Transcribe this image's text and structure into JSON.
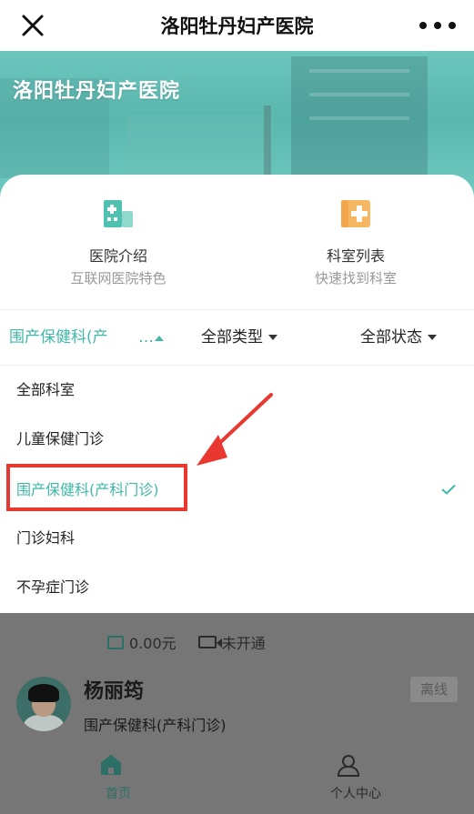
{
  "navbar": {
    "title": "洛阳牡丹妇产医院",
    "close_icon": "close-icon",
    "more_icon": "more-dots-icon"
  },
  "banner": {
    "hospital_name": "洛阳牡丹妇产医院"
  },
  "quick_links": [
    {
      "title": "医院介绍",
      "subtitle": "互联网医院特色",
      "icon": "hospital-building-icon"
    },
    {
      "title": "科室列表",
      "subtitle": "快速找到科室",
      "icon": "department-plus-icon"
    }
  ],
  "filters": {
    "department": {
      "label": "围产保健科(产科门诊)",
      "visible_label": "围产保健科(产",
      "ellipsis": "…"
    },
    "type": {
      "label": "全部类型"
    },
    "status": {
      "label": "全部状态"
    }
  },
  "dropdown": {
    "items": [
      {
        "label": "全部科室",
        "selected": false
      },
      {
        "label": "儿童保健门诊",
        "selected": false
      },
      {
        "label": "围产保健科(产科门诊)",
        "selected": true
      },
      {
        "label": "门诊妇科",
        "selected": false
      },
      {
        "label": "不孕症门诊",
        "selected": false
      }
    ]
  },
  "doctor_card": {
    "price": "0.00元",
    "video_status": "未开通",
    "name": "杨丽筠",
    "department": "围产保健科(产科门诊)",
    "badge": "离线"
  },
  "tabbar": {
    "items": [
      {
        "label": "首页",
        "icon": "home-icon",
        "active": true
      },
      {
        "label": "个人中心",
        "icon": "user-icon",
        "active": false
      }
    ]
  },
  "colors": {
    "accent": "#3fb8a9",
    "annotation": "#e8382f"
  }
}
